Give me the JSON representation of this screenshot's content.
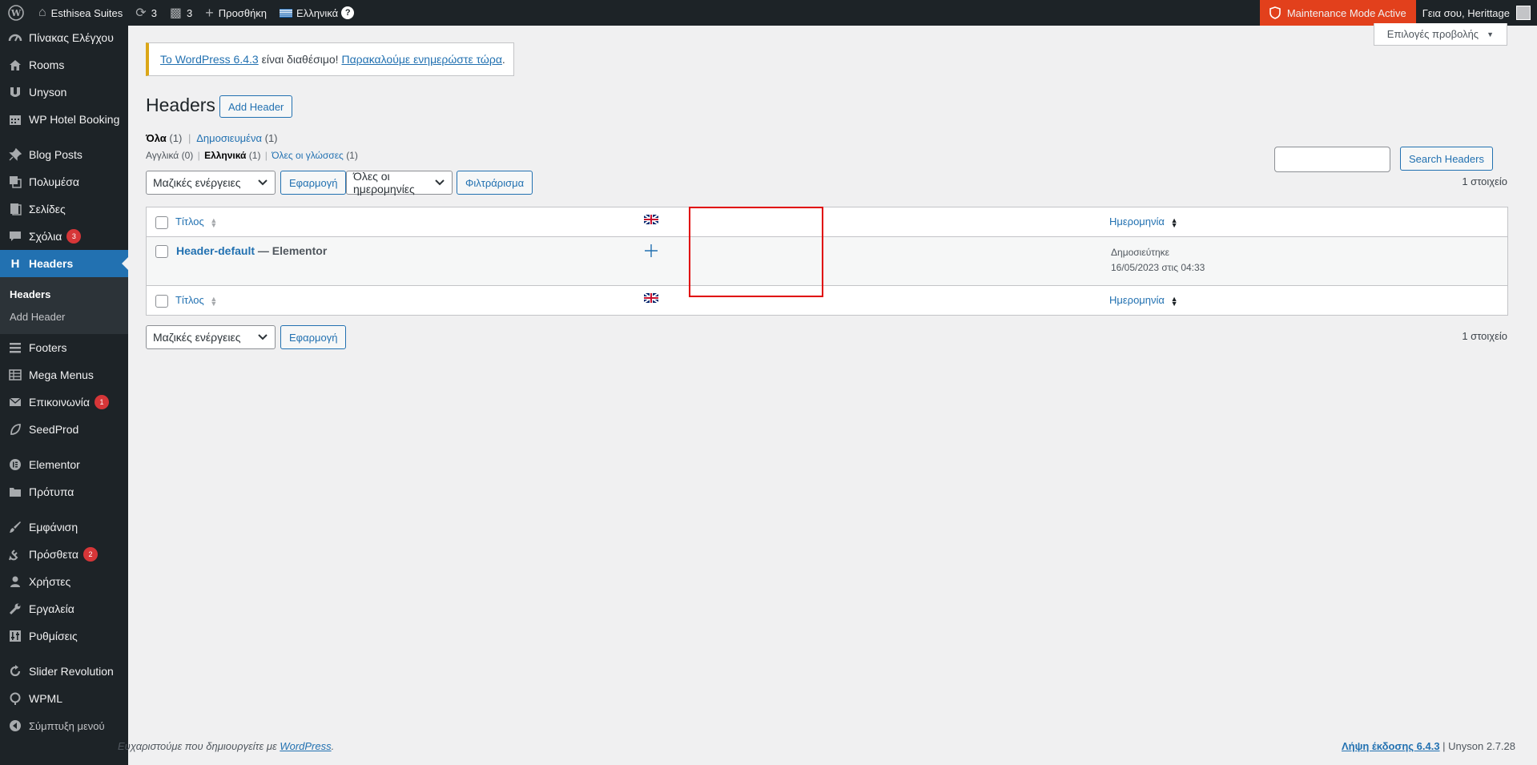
{
  "adminbar": {
    "site_name": "Esthisea Suites",
    "updates_count": "3",
    "comments_count": "3",
    "new_label": "Προσθήκη",
    "language_label": "Ελληνικά",
    "help_glyph": "?",
    "maintenance_label": "Maintenance Mode Active",
    "greeting": "Γεια σου, Herittage",
    "maintenance_color": "#e2401c"
  },
  "sidebar": {
    "items": [
      {
        "label": "Πίνακας Ελέγχου",
        "icon": "dashboard-icon"
      },
      {
        "label": "Rooms",
        "icon": "house-icon"
      },
      {
        "label": "Unyson",
        "icon": "unyson-icon"
      },
      {
        "label": "WP Hotel Booking",
        "icon": "calendar-icon"
      },
      {
        "label": "Blog Posts",
        "icon": "pin-icon"
      },
      {
        "label": "Πολυμέσα",
        "icon": "media-icon"
      },
      {
        "label": "Σελίδες",
        "icon": "pages-icon"
      },
      {
        "label": "Σχόλια",
        "icon": "comment-icon",
        "badge": "3"
      },
      {
        "label": "Headers",
        "icon": "h-icon"
      },
      {
        "label": "Footers",
        "icon": "list-icon"
      },
      {
        "label": "Mega Menus",
        "icon": "table-icon"
      },
      {
        "label": "Επικοινωνία",
        "icon": "mail-icon",
        "badge": "1"
      },
      {
        "label": "SeedProd",
        "icon": "leaf-icon"
      },
      {
        "label": "Elementor",
        "icon": "elementor-icon"
      },
      {
        "label": "Πρότυπα",
        "icon": "folder-icon"
      },
      {
        "label": "Εμφάνιση",
        "icon": "brush-icon"
      },
      {
        "label": "Πρόσθετα",
        "icon": "plugin-icon",
        "badge": "2"
      },
      {
        "label": "Χρήστες",
        "icon": "user-icon"
      },
      {
        "label": "Εργαλεία",
        "icon": "wrench-icon"
      },
      {
        "label": "Ρυθμίσεις",
        "icon": "settings-icon"
      },
      {
        "label": "Slider Revolution",
        "icon": "refresh-icon"
      },
      {
        "label": "WPML",
        "icon": "wpml-icon"
      },
      {
        "label": "Σύμπτυξη μενού",
        "icon": "collapse-icon"
      }
    ],
    "submenu": [
      "Headers",
      "Add Header"
    ]
  },
  "main": {
    "screen_options": "Επιλογές προβολής",
    "notice": {
      "link1": "Το WordPress 6.4.3",
      "text": " είναι διαθέσιμο! ",
      "link2": "Παρακαλούμε ενημερώστε τώρα",
      "end": "."
    },
    "title": "Headers",
    "add_button": "Add Header",
    "status_links": {
      "all": "Όλα",
      "all_count": "(1)",
      "published": "Δημοσιευμένα",
      "published_count": "(1)"
    },
    "lang_links": {
      "english": "Αγγλικά",
      "english_count": "(0)",
      "greek": "Ελληνικά",
      "greek_count": "(1)",
      "all": "Όλες οι γλώσσες",
      "all_count": "(1)"
    },
    "search_button": "Search Headers",
    "bulk_actions": "Μαζικές ενέργειες",
    "apply": "Εφαρμογή",
    "dates": "Όλες οι ημερομηνίες",
    "filter": "Φιλτράρισμα",
    "items_count": "1 στοιχείο",
    "table": {
      "col_title": "Τίτλος",
      "col_date": "Ημερομηνία",
      "row": {
        "title": "Header-default",
        "suffix": " — Elementor",
        "status": "Δημοσιεύτηκε",
        "date": "16/05/2023 στις 04:33"
      }
    },
    "footer_left_text": "Ευχαριστούμε που δημιουργείτε με ",
    "footer_left_link": "WordPress",
    "footer_left_end": ".",
    "footer_right_link": "Λήψη έκδοσης 6.4.3",
    "footer_right_text": " | Unyson 2.7.28"
  }
}
